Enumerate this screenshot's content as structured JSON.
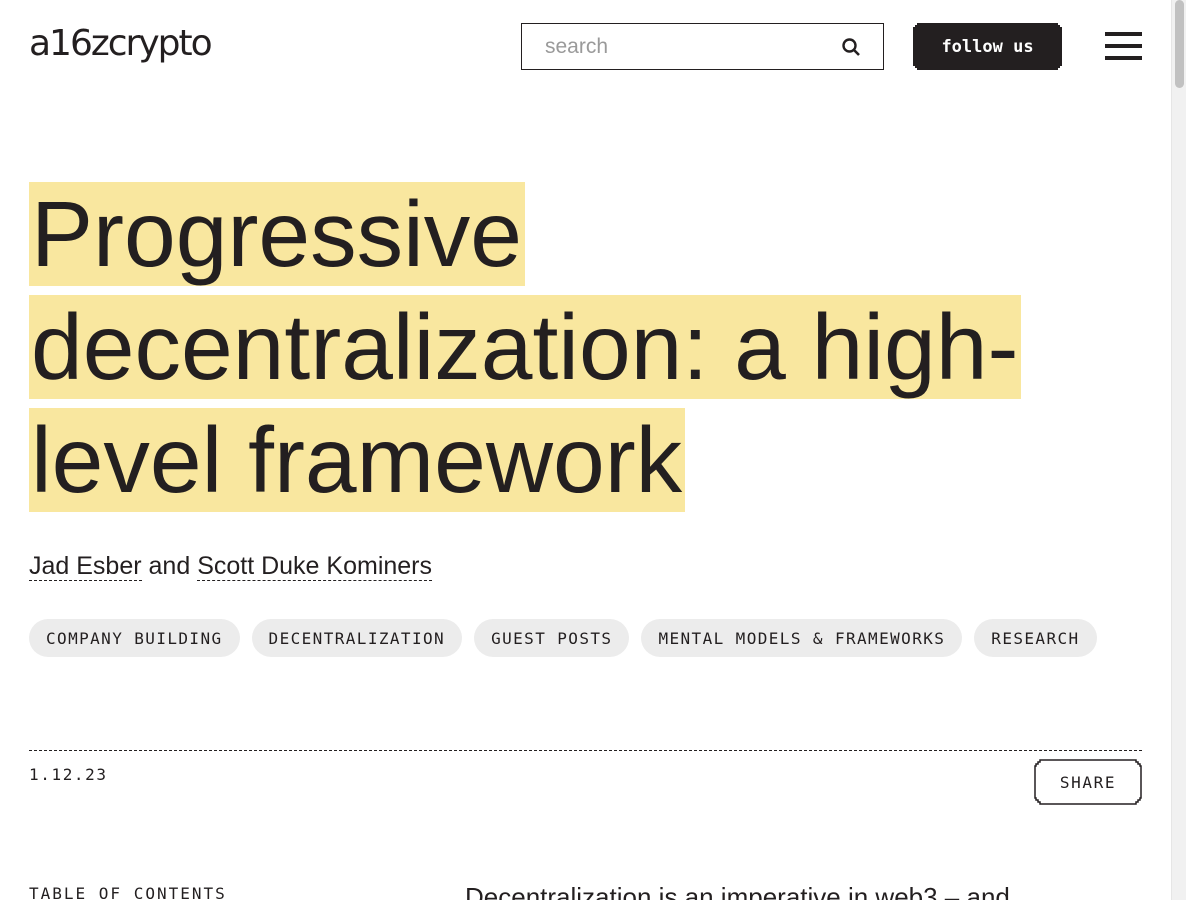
{
  "header": {
    "logo_text": "a16zcrypto",
    "search_placeholder": "search",
    "follow_label": "follow us"
  },
  "article": {
    "title_lines": [
      "Progressive",
      "decentralization: a high-",
      "level framework"
    ],
    "authors": [
      {
        "name": "Jad Esber"
      },
      {
        "name": "Scott Duke Kominers"
      }
    ],
    "author_joiner": "and",
    "tags": [
      "COMPANY BUILDING",
      "DECENTRALIZATION",
      "GUEST POSTS",
      "MENTAL MODELS & FRAMEWORKS",
      "RESEARCH"
    ],
    "date": "1.12.23",
    "share_label": "SHARE",
    "toc_heading": "TABLE OF CONTENTS",
    "body_intro_start": "Decentralization",
    "body_intro_rest": " is an imperative in web3 – and"
  },
  "colors": {
    "text": "#231f20",
    "highlight": "#f9e79f",
    "tag_bg": "#ececec"
  }
}
